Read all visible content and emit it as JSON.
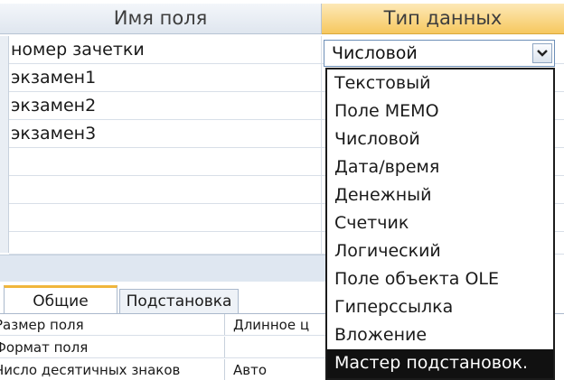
{
  "table_design": {
    "header": {
      "field_name": "Имя поля",
      "data_type": "Тип данных"
    },
    "rows": [
      {
        "name": "номер зачетки"
      },
      {
        "name": "экзамен1"
      },
      {
        "name": "экзамен2"
      },
      {
        "name": "экзамен3"
      }
    ],
    "current_type": "Числовой",
    "dropdown_arrow": "chevron-down-icon"
  },
  "type_options": [
    {
      "label": "Текстовый"
    },
    {
      "label": "Поле MEMO"
    },
    {
      "label": "Числовой"
    },
    {
      "label": "Дата/время"
    },
    {
      "label": "Денежный"
    },
    {
      "label": "Счетчик"
    },
    {
      "label": "Логический"
    },
    {
      "label": "Поле объекта OLE"
    },
    {
      "label": "Гиперссылка"
    },
    {
      "label": "Вложение"
    },
    {
      "label": "Мастер подстановок."
    }
  ],
  "properties": {
    "tabs": [
      "Общие",
      "Подстановка"
    ],
    "items": [
      {
        "name": "Размер поля",
        "value": "Длинное ц"
      },
      {
        "name": "Формат поля",
        "value": ""
      },
      {
        "name": "Число десятичных знаков",
        "value": "Авто"
      }
    ]
  },
  "colors": {
    "selected_item_bg": "#111111",
    "header_type_bg": "#f6c85f",
    "tab_accent": "#f0b63c"
  }
}
